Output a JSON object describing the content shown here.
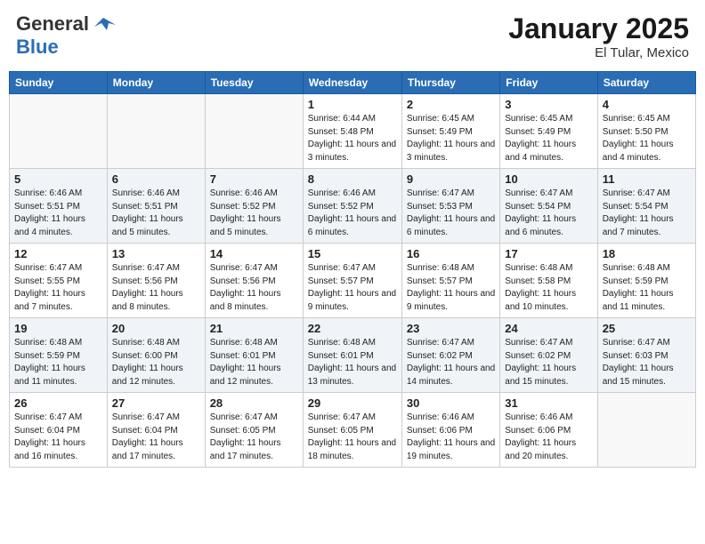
{
  "header": {
    "logo_line1": "General",
    "logo_line2": "Blue",
    "month": "January 2025",
    "location": "El Tular, Mexico"
  },
  "weekdays": [
    "Sunday",
    "Monday",
    "Tuesday",
    "Wednesday",
    "Thursday",
    "Friday",
    "Saturday"
  ],
  "weeks": [
    [
      {
        "day": "",
        "sunrise": "",
        "sunset": "",
        "daylight": ""
      },
      {
        "day": "",
        "sunrise": "",
        "sunset": "",
        "daylight": ""
      },
      {
        "day": "",
        "sunrise": "",
        "sunset": "",
        "daylight": ""
      },
      {
        "day": "1",
        "sunrise": "Sunrise: 6:44 AM",
        "sunset": "Sunset: 5:48 PM",
        "daylight": "Daylight: 11 hours and 3 minutes."
      },
      {
        "day": "2",
        "sunrise": "Sunrise: 6:45 AM",
        "sunset": "Sunset: 5:49 PM",
        "daylight": "Daylight: 11 hours and 3 minutes."
      },
      {
        "day": "3",
        "sunrise": "Sunrise: 6:45 AM",
        "sunset": "Sunset: 5:49 PM",
        "daylight": "Daylight: 11 hours and 4 minutes."
      },
      {
        "day": "4",
        "sunrise": "Sunrise: 6:45 AM",
        "sunset": "Sunset: 5:50 PM",
        "daylight": "Daylight: 11 hours and 4 minutes."
      }
    ],
    [
      {
        "day": "5",
        "sunrise": "Sunrise: 6:46 AM",
        "sunset": "Sunset: 5:51 PM",
        "daylight": "Daylight: 11 hours and 4 minutes."
      },
      {
        "day": "6",
        "sunrise": "Sunrise: 6:46 AM",
        "sunset": "Sunset: 5:51 PM",
        "daylight": "Daylight: 11 hours and 5 minutes."
      },
      {
        "day": "7",
        "sunrise": "Sunrise: 6:46 AM",
        "sunset": "Sunset: 5:52 PM",
        "daylight": "Daylight: 11 hours and 5 minutes."
      },
      {
        "day": "8",
        "sunrise": "Sunrise: 6:46 AM",
        "sunset": "Sunset: 5:52 PM",
        "daylight": "Daylight: 11 hours and 6 minutes."
      },
      {
        "day": "9",
        "sunrise": "Sunrise: 6:47 AM",
        "sunset": "Sunset: 5:53 PM",
        "daylight": "Daylight: 11 hours and 6 minutes."
      },
      {
        "day": "10",
        "sunrise": "Sunrise: 6:47 AM",
        "sunset": "Sunset: 5:54 PM",
        "daylight": "Daylight: 11 hours and 6 minutes."
      },
      {
        "day": "11",
        "sunrise": "Sunrise: 6:47 AM",
        "sunset": "Sunset: 5:54 PM",
        "daylight": "Daylight: 11 hours and 7 minutes."
      }
    ],
    [
      {
        "day": "12",
        "sunrise": "Sunrise: 6:47 AM",
        "sunset": "Sunset: 5:55 PM",
        "daylight": "Daylight: 11 hours and 7 minutes."
      },
      {
        "day": "13",
        "sunrise": "Sunrise: 6:47 AM",
        "sunset": "Sunset: 5:56 PM",
        "daylight": "Daylight: 11 hours and 8 minutes."
      },
      {
        "day": "14",
        "sunrise": "Sunrise: 6:47 AM",
        "sunset": "Sunset: 5:56 PM",
        "daylight": "Daylight: 11 hours and 8 minutes."
      },
      {
        "day": "15",
        "sunrise": "Sunrise: 6:47 AM",
        "sunset": "Sunset: 5:57 PM",
        "daylight": "Daylight: 11 hours and 9 minutes."
      },
      {
        "day": "16",
        "sunrise": "Sunrise: 6:48 AM",
        "sunset": "Sunset: 5:57 PM",
        "daylight": "Daylight: 11 hours and 9 minutes."
      },
      {
        "day": "17",
        "sunrise": "Sunrise: 6:48 AM",
        "sunset": "Sunset: 5:58 PM",
        "daylight": "Daylight: 11 hours and 10 minutes."
      },
      {
        "day": "18",
        "sunrise": "Sunrise: 6:48 AM",
        "sunset": "Sunset: 5:59 PM",
        "daylight": "Daylight: 11 hours and 11 minutes."
      }
    ],
    [
      {
        "day": "19",
        "sunrise": "Sunrise: 6:48 AM",
        "sunset": "Sunset: 5:59 PM",
        "daylight": "Daylight: 11 hours and 11 minutes."
      },
      {
        "day": "20",
        "sunrise": "Sunrise: 6:48 AM",
        "sunset": "Sunset: 6:00 PM",
        "daylight": "Daylight: 11 hours and 12 minutes."
      },
      {
        "day": "21",
        "sunrise": "Sunrise: 6:48 AM",
        "sunset": "Sunset: 6:01 PM",
        "daylight": "Daylight: 11 hours and 12 minutes."
      },
      {
        "day": "22",
        "sunrise": "Sunrise: 6:48 AM",
        "sunset": "Sunset: 6:01 PM",
        "daylight": "Daylight: 11 hours and 13 minutes."
      },
      {
        "day": "23",
        "sunrise": "Sunrise: 6:47 AM",
        "sunset": "Sunset: 6:02 PM",
        "daylight": "Daylight: 11 hours and 14 minutes."
      },
      {
        "day": "24",
        "sunrise": "Sunrise: 6:47 AM",
        "sunset": "Sunset: 6:02 PM",
        "daylight": "Daylight: 11 hours and 15 minutes."
      },
      {
        "day": "25",
        "sunrise": "Sunrise: 6:47 AM",
        "sunset": "Sunset: 6:03 PM",
        "daylight": "Daylight: 11 hours and 15 minutes."
      }
    ],
    [
      {
        "day": "26",
        "sunrise": "Sunrise: 6:47 AM",
        "sunset": "Sunset: 6:04 PM",
        "daylight": "Daylight: 11 hours and 16 minutes."
      },
      {
        "day": "27",
        "sunrise": "Sunrise: 6:47 AM",
        "sunset": "Sunset: 6:04 PM",
        "daylight": "Daylight: 11 hours and 17 minutes."
      },
      {
        "day": "28",
        "sunrise": "Sunrise: 6:47 AM",
        "sunset": "Sunset: 6:05 PM",
        "daylight": "Daylight: 11 hours and 17 minutes."
      },
      {
        "day": "29",
        "sunrise": "Sunrise: 6:47 AM",
        "sunset": "Sunset: 6:05 PM",
        "daylight": "Daylight: 11 hours and 18 minutes."
      },
      {
        "day": "30",
        "sunrise": "Sunrise: 6:46 AM",
        "sunset": "Sunset: 6:06 PM",
        "daylight": "Daylight: 11 hours and 19 minutes."
      },
      {
        "day": "31",
        "sunrise": "Sunrise: 6:46 AM",
        "sunset": "Sunset: 6:06 PM",
        "daylight": "Daylight: 11 hours and 20 minutes."
      },
      {
        "day": "",
        "sunrise": "",
        "sunset": "",
        "daylight": ""
      }
    ]
  ]
}
